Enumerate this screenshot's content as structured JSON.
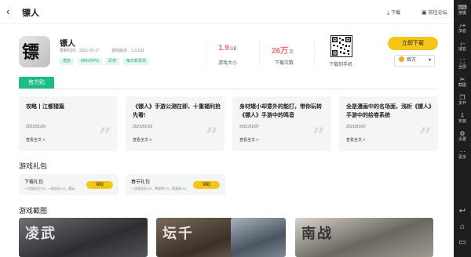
{
  "header": {
    "back_icon": "back-arrow-icon",
    "title": "镖人",
    "download_label": "下载",
    "forum_label": "前往论坛"
  },
  "game": {
    "icon_glyph": "镖人",
    "name": "镖人",
    "update_time": "更新时间：2021-03-17",
    "version": "游戏版本：1.3.103",
    "tags": [
      "角色",
      "MMORPG",
      "武侠",
      "每日新发现"
    ]
  },
  "stats": {
    "size_value": "1.9",
    "size_unit": "GB",
    "size_label": "游戏大小",
    "downloads_value": "26万",
    "downloads_unit": "次",
    "downloads_label": "下载次数",
    "qr_label": "下载到手机"
  },
  "download": {
    "button_label": "立即下载",
    "channel_label": "官方"
  },
  "official_tab": "官方贴",
  "articles": [
    {
      "title": "攻略丨江都猎篇",
      "date": "2021/01/26",
      "more": "查看全文 >"
    },
    {
      "title": "《镖人》手游公测在即，十重福利抢先看!",
      "date": "2021/01/19",
      "more": "查看全文 >"
    },
    {
      "title": "身材矮小却意外的能打，带你玩转《镖人》手游中的鸣音",
      "date": "2021/01/07",
      "more": "查看全文 >"
    },
    {
      "title": "全是漫画中的名场面，浅析《镖人》手游中的绘卷系统",
      "date": "2021/01/07",
      "more": "查看全文 >"
    }
  ],
  "gifts_section_title": "游戏礼包",
  "gifts": [
    {
      "name": "下载礼包",
      "desc": "一品强化石*10，一级宝石*10，重云...",
      "button": "领取"
    },
    {
      "name": "春节礼包",
      "desc": "一品强化石*10，降星铭*10，紫晶铜*10",
      "button": "领取"
    }
  ],
  "screenshots_section_title": "游戏截图",
  "screenshots": [
    {
      "overlay": "凌武"
    },
    {
      "overlay": "坛千"
    },
    {
      "overlay": ""
    },
    {
      "overlay": "南战"
    }
  ],
  "sidebar": {
    "items": [
      {
        "icon": "keys-icon",
        "label": "按键"
      },
      {
        "icon": "volume-up-icon",
        "label": "加音"
      },
      {
        "icon": "volume-down-icon",
        "label": "减音"
      },
      {
        "icon": "fullscreen-icon",
        "label": "全屏"
      },
      {
        "icon": "screenshot-icon",
        "label": "截图"
      },
      {
        "icon": "multi-instance-icon",
        "label": "多开"
      },
      {
        "icon": "install-icon",
        "label": "安装"
      },
      {
        "icon": "settings-icon",
        "label": "设置"
      },
      {
        "icon": "more-icon",
        "label": "更多"
      }
    ],
    "nav": [
      "back-icon",
      "home-icon",
      "recent-apps-icon"
    ]
  },
  "colors": {
    "accent_yellow": "#f5c518",
    "accent_green": "#1dbb87",
    "stat_red": "#f26d6d"
  }
}
